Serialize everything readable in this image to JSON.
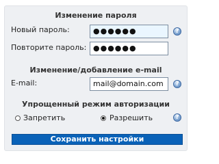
{
  "password_section": {
    "title": "Изменение пароля",
    "new_password_label": "Новый пароль:",
    "new_password_value": "●●●●●●",
    "repeat_password_label": "Повторите пароль:",
    "repeat_password_value": "●●●●●●"
  },
  "email_section": {
    "title": "Изменение/добавление e-mail",
    "email_label": "E-mail:",
    "email_value": "mail@domain.com"
  },
  "auth_section": {
    "title": "Упрощенный режим авторизации",
    "option_deny": "Запретить",
    "option_allow": "Разрешить",
    "selected": "Разрешить"
  },
  "help_icon": "?",
  "save_button_label": "Сохранить настройки",
  "colors": {
    "panel_bg": "#eef0f3",
    "input_bg": "#eaf6ff",
    "button_bg": "#0a62b8",
    "help_icon": "#4f7fb8"
  }
}
